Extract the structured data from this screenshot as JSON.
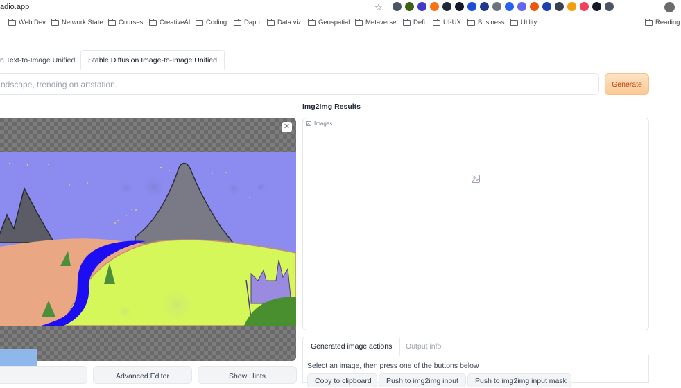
{
  "browser": {
    "url": "adio.app",
    "bookmarks": [
      "Web Dev",
      "Network State",
      "Courses",
      "CreativeAI",
      "Coding",
      "Dapp",
      "Data viz",
      "Geospatial",
      "Metaverse",
      "Defi",
      "UI-UX",
      "Business",
      "Utility"
    ],
    "reading_list": "Reading L",
    "extension_colors": [
      "#4b5563",
      "#3f6212",
      "#4338ca",
      "#f97316",
      "#1f2937",
      "#111827",
      "#1d4ed8",
      "#1e3a8a",
      "#6b7280",
      "#2563eb",
      "#6366f1",
      "#ea580c",
      "#1e40af",
      "#374151",
      "#f59e0b",
      "#f43f5e",
      "#111827",
      "#4b5563"
    ]
  },
  "tabs": {
    "text_to_image": "n Text-to-Image Unified",
    "image_to_image": "Stable Diffusion Image-to-Image Unified"
  },
  "prompt": {
    "placeholder": "ndscape, trending on artstation."
  },
  "generate_label": "Generate",
  "editor": {
    "advanced_editor_label": "Advanced Editor",
    "show_hints_label": "Show Hints"
  },
  "results": {
    "title": "Img2Img Results",
    "gallery_label": "Images"
  },
  "actions": {
    "tabs": [
      "Generated image actions",
      "Output info"
    ],
    "instruction": "Select an image, then press one of the buttons below",
    "buttons": [
      "Copy to clipboard",
      "Push to img2img input",
      "Push to img2img input mask"
    ]
  }
}
